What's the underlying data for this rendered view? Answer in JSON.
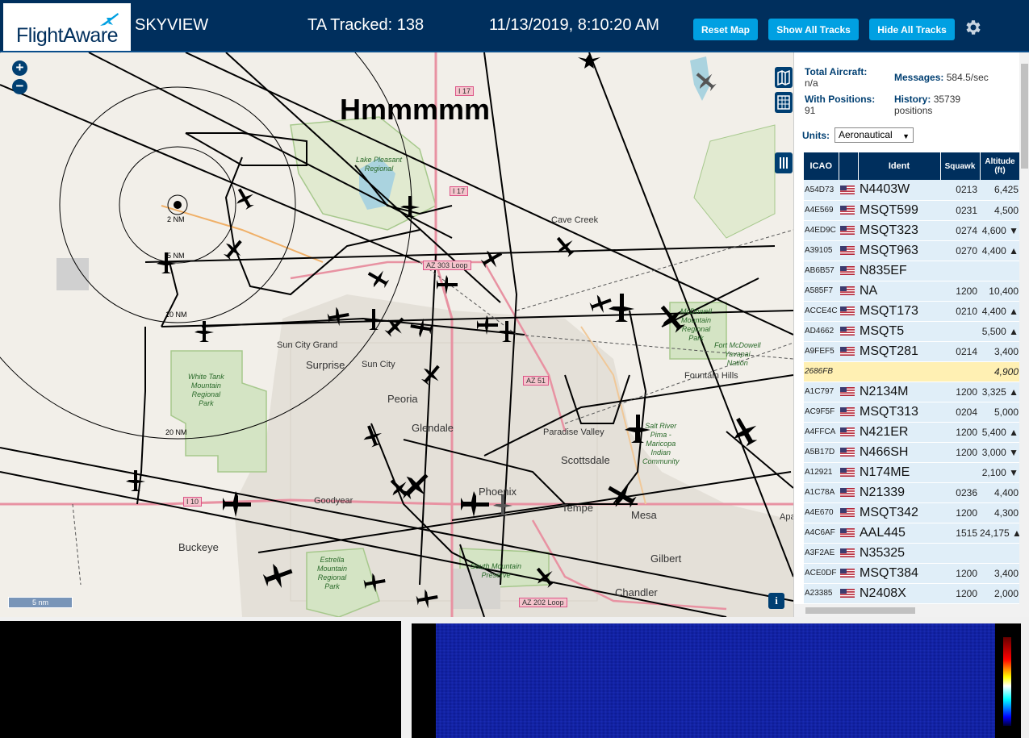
{
  "header": {
    "logo": "FlightAware",
    "title": "SKYVIEW",
    "tracked": "TA Tracked: 138",
    "datetime": "11/13/2019, 8:10:20 AM",
    "reset_map": "Reset Map",
    "show_all": "Show All Tracks",
    "hide_all": "Hide All Tracks"
  },
  "map": {
    "overlay_text": "Hmmmmm",
    "ring_labels": [
      "2 NM",
      "5 NM",
      "10 NM",
      "20 NM"
    ],
    "scale": "5 nm",
    "info": "i",
    "places": {
      "cave_creek": "Cave Creek",
      "sun_city_grand": "Sun City Grand",
      "surprise": "Surprise",
      "sun_city": "Sun City",
      "peoria": "Peoria",
      "glendale": "Glendale",
      "paradise_valley": "Paradise Valley",
      "scottsdale": "Scottsdale",
      "phoenix": "Phoenix",
      "tempe": "Tempe",
      "mesa": "Mesa",
      "gilbert": "Gilbert",
      "chandler": "Chandler",
      "buckeye": "Buckeye",
      "goodyear": "Goodyear",
      "fountain_hills": "Fountain Hills",
      "apa": "Apa"
    },
    "parks": {
      "white_tank": "White Tank\nMountain\nRegional\nPark",
      "estrella": "Estrella\nMountain\nRegional\nPark",
      "south_mountain": "South Mountain\nPreserve",
      "mcdowell": "McDowell\nMountain\nRegional\nPark",
      "fort_mcdowell": "Fort McDowell\nYavapai\nNation",
      "salt_river": "Salt River\nPima -\nMaricopa\nIndian\nCommunity",
      "lake_pleasant": "Lake Pleasant\nRegional"
    },
    "roads": [
      "I 17",
      "I 17",
      "AZ 303 Loop",
      "AZ 51",
      "I 10",
      "AZ 202 Loop"
    ]
  },
  "panel": {
    "total_aircraft_label": "Total Aircraft:",
    "total_aircraft_value": "n/a",
    "messages_label": "Messages:",
    "messages_value": "584.5/sec",
    "with_positions_label": "With Positions:",
    "with_positions_value": "91",
    "history_label": "History:",
    "history_value": "35739",
    "history_unit": "positions",
    "units_label": "Units:",
    "units_value": "Aeronautical",
    "columns": [
      "ICAO",
      "",
      "Ident",
      "Squawk",
      "Altitude (ft)"
    ],
    "rows": [
      {
        "icao": "A54D73",
        "ident": "N4403W",
        "squawk": "0213",
        "alt": "6,425"
      },
      {
        "icao": "A4E569",
        "ident": "MSQT599",
        "squawk": "0231",
        "alt": "4,500"
      },
      {
        "icao": "A4ED9C",
        "ident": "MSQT323",
        "squawk": "0274",
        "alt": "4,600 ▼"
      },
      {
        "icao": "A39105",
        "ident": "MSQT963",
        "squawk": "0270",
        "alt": "4,400 ▲"
      },
      {
        "icao": "AB6B57",
        "ident": "N835EF",
        "squawk": "",
        "alt": ""
      },
      {
        "icao": "A585F7",
        "ident": "NA",
        "squawk": "1200",
        "alt": "10,400"
      },
      {
        "icao": "ACCE4C",
        "ident": "MSQT173",
        "squawk": "0210",
        "alt": "4,400 ▲"
      },
      {
        "icao": "AD4662",
        "ident": "MSQT5",
        "squawk": "",
        "alt": "5,500 ▲"
      },
      {
        "icao": "A9FEF5",
        "ident": "MSQT281",
        "squawk": "0214",
        "alt": "3,400"
      },
      {
        "icao": "2686FB",
        "ident": "",
        "squawk": "",
        "alt": "4,900",
        "highlight": true,
        "noflag": true
      },
      {
        "icao": "A1C797",
        "ident": "N2134M",
        "squawk": "1200",
        "alt": "3,325 ▲"
      },
      {
        "icao": "AC9F5F",
        "ident": "MSQT313",
        "squawk": "0204",
        "alt": "5,000"
      },
      {
        "icao": "A4FFCA",
        "ident": "N421ER",
        "squawk": "1200",
        "alt": "5,400 ▲"
      },
      {
        "icao": "A5B17D",
        "ident": "N466SH",
        "squawk": "1200",
        "alt": "3,000 ▼"
      },
      {
        "icao": "A12921",
        "ident": "N174ME",
        "squawk": "",
        "alt": "2,100 ▼"
      },
      {
        "icao": "A1C78A",
        "ident": "N21339",
        "squawk": "0236",
        "alt": "4,400"
      },
      {
        "icao": "A4E670",
        "ident": "MSQT342",
        "squawk": "1200",
        "alt": "4,300"
      },
      {
        "icao": "A4C6AF",
        "ident": "AAL445",
        "squawk": "1515",
        "alt": "24,175 ▲"
      },
      {
        "icao": "A3F2AE",
        "ident": "N35325",
        "squawk": "",
        "alt": ""
      },
      {
        "icao": "ACE0DF",
        "ident": "MSQT384",
        "squawk": "1200",
        "alt": "3,400"
      },
      {
        "icao": "A23385",
        "ident": "N2408X",
        "squawk": "1200",
        "alt": "2,000"
      }
    ]
  },
  "colors": {
    "header_bg": "#002f5d",
    "button": "#00a0e2",
    "row_bg": "#e0eef8",
    "row_highlight": "#fff0b3"
  }
}
